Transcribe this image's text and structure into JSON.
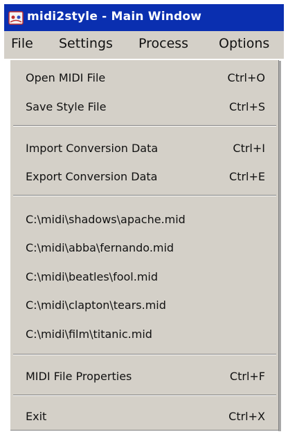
{
  "window": {
    "title": "midi2style - Main Window"
  },
  "menubar": {
    "items": [
      "File",
      "Settings",
      "Process",
      "Options"
    ]
  },
  "file_menu": {
    "open": {
      "label": "Open MIDI File",
      "shortcut": "Ctrl+O"
    },
    "save": {
      "label": "Save Style File",
      "shortcut": "Ctrl+S"
    },
    "import": {
      "label": "Import Conversion Data",
      "shortcut": "Ctrl+I"
    },
    "export": {
      "label": "Export Conversion Data",
      "shortcut": "Ctrl+E"
    },
    "recent": [
      "C:\\midi\\shadows\\apache.mid",
      "C:\\midi\\abba\\fernando.mid",
      "C:\\midi\\beatles\\fool.mid",
      "C:\\midi\\clapton\\tears.mid",
      "C:\\midi\\film\\titanic.mid"
    ],
    "properties": {
      "label": "MIDI File Properties",
      "shortcut": "Ctrl+F"
    },
    "exit": {
      "label": "Exit",
      "shortcut": "Ctrl+X"
    }
  }
}
